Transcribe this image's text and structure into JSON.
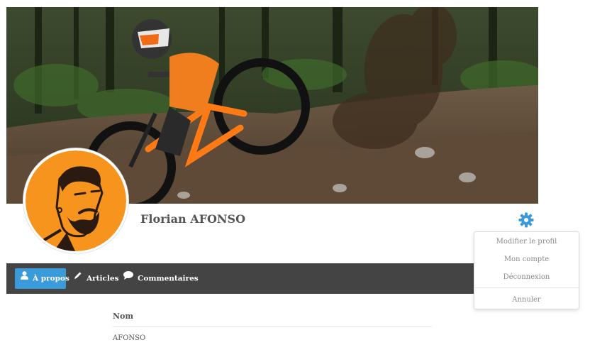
{
  "profile": {
    "name": "Florian AFONSO"
  },
  "menu": {
    "items": [
      {
        "label": "Modifier le profil"
      },
      {
        "label": "Mon compte"
      },
      {
        "label": "Déconnexion"
      }
    ],
    "cancel_label": "Annuler"
  },
  "tabs": [
    {
      "label": "À propos",
      "icon": "user-icon",
      "active": true
    },
    {
      "label": "Articles",
      "icon": "pencil-icon",
      "active": false
    },
    {
      "label": "Commentaires",
      "icon": "comment-icon",
      "active": false
    }
  ],
  "about": {
    "field_label": "Nom",
    "field_value": "AFONSO"
  },
  "colors": {
    "accent": "#3b9ad9",
    "navbar": "#444444",
    "avatar_bg": "#f7941d"
  }
}
